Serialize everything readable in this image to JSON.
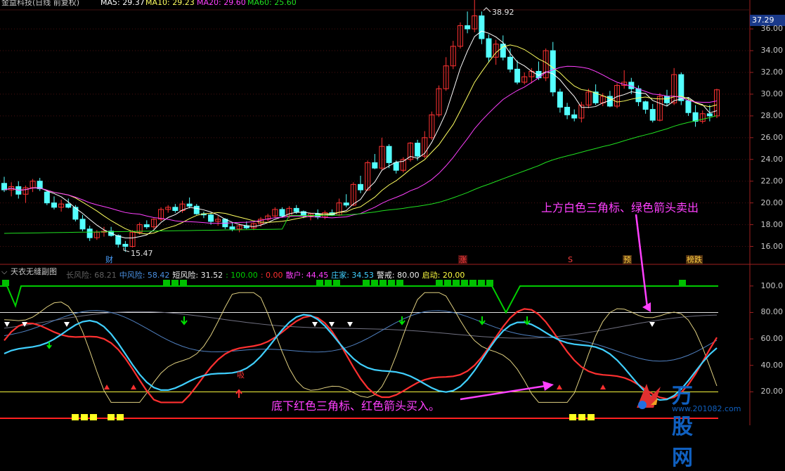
{
  "top_header": {
    "stock_name": "金益科技(日线 前复权)",
    "ma5": "MA5: 29.37",
    "ma10": "MA10: 29.23",
    "ma20": "MA20: 29.60",
    "ma60": "MA60: 25.60"
  },
  "price_axis": {
    "current": "37.29",
    "ticks": [
      "36.00",
      "34.00",
      "32.00",
      "30.00",
      "28.00",
      "26.00",
      "24.00",
      "22.00",
      "20.00",
      "18.00",
      "16.00"
    ]
  },
  "peak_label": "38.92",
  "low_label": "15.47",
  "markers": {
    "cai": "财",
    "zhang": "涨",
    "s": "S",
    "yu": "预",
    "bang": "榜跌"
  },
  "sub_header": {
    "title": "天衣无缝副图",
    "items": [
      {
        "text": "长风险: 68.21",
        "color": "#606060"
      },
      {
        "text": "中风险: 58.42",
        "color": "#4a90e2"
      },
      {
        "text": "短风险: 31.52",
        "color": "#f0f0f0"
      },
      {
        "text": ": 100.00",
        "color": "#00d000"
      },
      {
        "text": ": 0.00",
        "color": "#ff3030"
      },
      {
        "text": "散户: 44.45",
        "color": "#ff40ff"
      },
      {
        "text": "庄家: 34.53",
        "color": "#40d0ff"
      },
      {
        "text": "警戒: 80.00",
        "color": "#f0f0f0"
      },
      {
        "text": "启动: 20.00",
        "color": "#ffff40"
      }
    ]
  },
  "sub_axis": {
    "ticks": [
      "100.0",
      "80.00",
      "60.00",
      "40.00",
      "20.00"
    ]
  },
  "annotations": {
    "sell": "上方白色三角标、绿色箭头卖出",
    "buy": "底下红色三角标、红色箭头买入。",
    "xi": "吸"
  },
  "watermark": {
    "brand": "万股网",
    "url": "www.201082.com"
  },
  "colors": {
    "up": "#ff3232",
    "down": "#54ffff",
    "ma5": "#ffffff",
    "ma10": "#ffff60",
    "ma20": "#ff40ff",
    "ma60": "#20e020",
    "annotation": "#ff40ff"
  },
  "chart_data": {
    "type": "candlestick",
    "price_range": [
      15,
      37.3
    ],
    "ohlc": [
      [
        21.8,
        22.4,
        21.0,
        21.2
      ],
      [
        21.2,
        21.9,
        20.6,
        21.5
      ],
      [
        21.5,
        22.0,
        20.4,
        20.8
      ],
      [
        20.8,
        21.6,
        20.0,
        21.4
      ],
      [
        21.4,
        22.2,
        21.0,
        22.0
      ],
      [
        22.0,
        22.3,
        21.1,
        21.3
      ],
      [
        21.0,
        21.2,
        19.8,
        20.0
      ],
      [
        20.0,
        20.6,
        19.4,
        19.6
      ],
      [
        19.6,
        20.3,
        19.2,
        19.9
      ],
      [
        19.9,
        20.4,
        19.5,
        19.6
      ],
      [
        19.6,
        19.8,
        18.3,
        18.5
      ],
      [
        18.5,
        18.9,
        17.4,
        17.6
      ],
      [
        17.6,
        17.9,
        16.5,
        16.8
      ],
      [
        16.8,
        17.5,
        16.6,
        17.3
      ],
      [
        17.3,
        17.8,
        16.9,
        17.4
      ],
      [
        17.4,
        17.8,
        16.9,
        17.0
      ],
      [
        17.0,
        17.1,
        15.9,
        16.2
      ],
      [
        16.2,
        16.5,
        15.5,
        16.0
      ],
      [
        16.0,
        17.5,
        15.9,
        17.3
      ],
      [
        17.3,
        18.2,
        17.1,
        18.0
      ],
      [
        18.0,
        18.4,
        17.6,
        17.8
      ],
      [
        17.8,
        18.6,
        17.6,
        18.5
      ],
      [
        18.5,
        19.6,
        18.3,
        19.4
      ],
      [
        19.4,
        19.8,
        19.1,
        19.6
      ],
      [
        19.6,
        19.9,
        19.1,
        19.3
      ],
      [
        19.3,
        20.2,
        19.1,
        19.9
      ],
      [
        19.9,
        20.5,
        19.5,
        19.7
      ],
      [
        19.7,
        19.9,
        18.9,
        19.0
      ],
      [
        19.0,
        19.2,
        18.6,
        18.9
      ],
      [
        18.9,
        19.1,
        18.0,
        18.3
      ],
      [
        18.3,
        18.8,
        17.9,
        18.5
      ],
      [
        18.5,
        18.6,
        17.6,
        17.8
      ],
      [
        17.8,
        18.2,
        17.4,
        17.6
      ],
      [
        17.6,
        18.1,
        17.3,
        17.9
      ],
      [
        17.9,
        18.3,
        17.6,
        17.7
      ],
      [
        17.7,
        18.2,
        17.5,
        18.1
      ],
      [
        18.1,
        18.7,
        17.8,
        18.5
      ],
      [
        18.5,
        19.0,
        18.3,
        18.8
      ],
      [
        18.8,
        19.6,
        18.6,
        19.4
      ],
      [
        19.4,
        19.6,
        18.7,
        18.8
      ],
      [
        18.8,
        19.7,
        18.6,
        19.5
      ],
      [
        19.5,
        19.8,
        19.0,
        19.2
      ],
      [
        19.2,
        19.3,
        18.6,
        18.8
      ],
      [
        18.8,
        19.1,
        18.4,
        19.0
      ],
      [
        19.0,
        19.4,
        18.5,
        18.7
      ],
      [
        18.7,
        19.3,
        18.5,
        19.1
      ],
      [
        19.1,
        19.4,
        18.8,
        18.9
      ],
      [
        18.9,
        20.4,
        18.8,
        20.0
      ],
      [
        20.0,
        20.8,
        19.6,
        19.8
      ],
      [
        19.8,
        21.9,
        19.7,
        21.7
      ],
      [
        21.7,
        22.5,
        20.9,
        21.2
      ],
      [
        21.2,
        23.9,
        21.1,
        23.7
      ],
      [
        23.7,
        24.5,
        23.1,
        23.2
      ],
      [
        23.2,
        26.0,
        23.0,
        25.2
      ],
      [
        25.2,
        25.4,
        23.2,
        23.7
      ],
      [
        23.7,
        23.9,
        22.7,
        23.0
      ],
      [
        23.0,
        24.2,
        22.8,
        24.0
      ],
      [
        24.0,
        25.6,
        23.8,
        25.5
      ],
      [
        25.5,
        25.8,
        23.9,
        24.3
      ],
      [
        24.3,
        26.6,
        24.1,
        26.0
      ],
      [
        26.0,
        28.4,
        25.8,
        28.1
      ],
      [
        28.1,
        30.8,
        27.9,
        30.5
      ],
      [
        30.5,
        33.4,
        30.3,
        32.6
      ],
      [
        32.6,
        34.9,
        32.3,
        34.4
      ],
      [
        34.4,
        36.6,
        34.2,
        36.3
      ],
      [
        36.3,
        37.6,
        35.6,
        36.0
      ],
      [
        36.0,
        38.92,
        35.7,
        37.2
      ],
      [
        37.2,
        37.6,
        34.6,
        35.1
      ],
      [
        35.1,
        35.5,
        32.9,
        33.4
      ],
      [
        33.4,
        35.0,
        32.7,
        34.6
      ],
      [
        34.6,
        35.4,
        33.1,
        33.4
      ],
      [
        33.4,
        34.2,
        32.0,
        32.3
      ],
      [
        32.3,
        33.1,
        30.9,
        31.1
      ],
      [
        31.1,
        32.0,
        30.9,
        31.6
      ],
      [
        31.6,
        32.4,
        31.0,
        32.1
      ],
      [
        32.1,
        33.0,
        31.3,
        31.5
      ],
      [
        31.5,
        34.2,
        31.2,
        34.0
      ],
      [
        34.0,
        34.8,
        29.8,
        30.2
      ],
      [
        30.2,
        30.5,
        28.3,
        28.8
      ],
      [
        28.8,
        29.2,
        27.7,
        28.1
      ],
      [
        28.1,
        28.6,
        27.5,
        27.8
      ],
      [
        27.8,
        29.3,
        27.4,
        29.0
      ],
      [
        29.0,
        30.5,
        28.7,
        30.2
      ],
      [
        30.2,
        30.9,
        29.0,
        29.2
      ],
      [
        29.2,
        30.1,
        28.9,
        29.8
      ],
      [
        29.8,
        30.3,
        28.8,
        28.9
      ],
      [
        28.9,
        31.0,
        28.7,
        30.8
      ],
      [
        30.8,
        32.2,
        30.5,
        31.1
      ],
      [
        31.1,
        31.5,
        30.0,
        30.5
      ],
      [
        30.5,
        30.8,
        28.9,
        29.3
      ],
      [
        29.3,
        29.4,
        28.2,
        28.6
      ],
      [
        28.6,
        29.1,
        27.4,
        27.6
      ],
      [
        27.6,
        30.1,
        27.5,
        29.8
      ],
      [
        29.8,
        30.4,
        28.9,
        29.2
      ],
      [
        29.2,
        32.4,
        29.0,
        31.8
      ],
      [
        31.8,
        32.0,
        29.0,
        29.4
      ],
      [
        29.4,
        29.7,
        28.0,
        28.3
      ],
      [
        28.3,
        29.0,
        27.0,
        27.5
      ],
      [
        27.5,
        28.5,
        27.3,
        28.2
      ],
      [
        28.2,
        29.0,
        27.5,
        28.0
      ],
      [
        28.0,
        30.5,
        27.8,
        30.4
      ]
    ]
  }
}
